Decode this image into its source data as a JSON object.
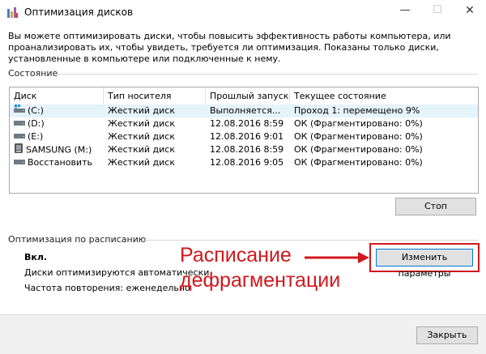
{
  "window": {
    "title": "Оптимизация дисков",
    "min_glyph": "—",
    "max_glyph": "☐",
    "close_glyph": "✕"
  },
  "description": "Вы можете оптимизировать диски, чтобы повысить эффективность работы  компьютера, или проанализировать их, чтобы увидеть, требуется ли оптимизация. Показаны только диски, установленные в компьютере или подключенные к нему.",
  "status_section": {
    "label": "Состояние",
    "columns": [
      "Диск",
      "Тип носителя",
      "Прошлый запуск",
      "Текущее состояние"
    ],
    "rows": [
      {
        "drive": "(C:)",
        "icon": "system-drive-icon",
        "media": "Жесткий диск",
        "last_run": "Выполняется...",
        "status": "Проход 1: перемещено 9%"
      },
      {
        "drive": "(D:)",
        "icon": "hard-drive-icon",
        "media": "Жесткий диск",
        "last_run": "12.08.2016 8:59",
        "status": "ОК (Фрагментировано: 0%)"
      },
      {
        "drive": "(E:)",
        "icon": "hard-drive-icon",
        "media": "Жесткий диск",
        "last_run": "12.08.2016 9:01",
        "status": "ОК (Фрагментировано: 0%)"
      },
      {
        "drive": "SAMSUNG (M:)",
        "icon": "usb-drive-icon",
        "media": "Жесткий диск",
        "last_run": "12.08.2016 8:59",
        "status": "ОК (Фрагментировано: 0%)"
      },
      {
        "drive": "Восстановить",
        "icon": "hard-drive-icon",
        "media": "Жесткий диск",
        "last_run": "12.08.2016 9:05",
        "status": "ОК (Фрагментировано: 0%)"
      }
    ],
    "stop_button": "Стоп"
  },
  "schedule_section": {
    "label": "Оптимизация по расписанию",
    "state": "Вкл.",
    "auto_text": "Диски оптимизируются автоматически.",
    "frequency_text": "Частота повторения: еженедельно",
    "change_button": "Изменить параметры"
  },
  "annotation": {
    "line1": "Расписание",
    "line2": "дефрагментации",
    "color": "#d0181e"
  },
  "footer": {
    "close_button": "Закрыть"
  }
}
